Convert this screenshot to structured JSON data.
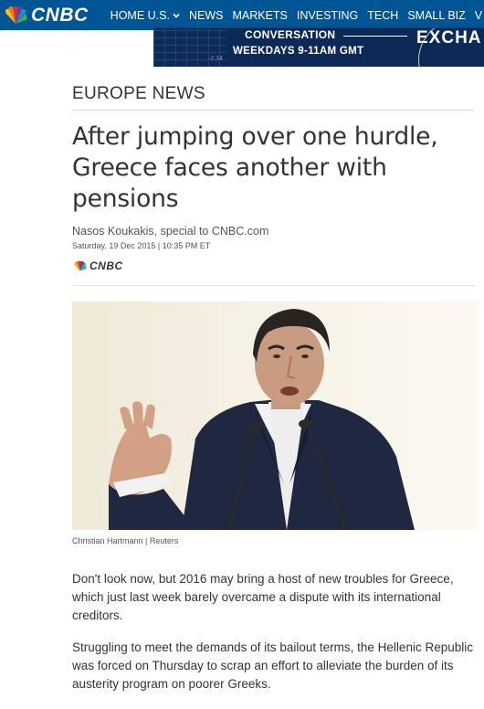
{
  "nav": {
    "logo_text": "CNBC",
    "items": [
      {
        "label": "HOME U.S.",
        "has_dropdown": true
      },
      {
        "label": "NEWS",
        "has_dropdown": false
      },
      {
        "label": "MARKETS",
        "has_dropdown": false
      },
      {
        "label": "INVESTING",
        "has_dropdown": false
      },
      {
        "label": "TECH",
        "has_dropdown": false
      },
      {
        "label": "SMALL BIZ",
        "has_dropdown": false
      },
      {
        "label": "V",
        "has_dropdown": false
      }
    ]
  },
  "ad": {
    "line1": "CONVERSATION",
    "line2": "WEEKDAYS 9-11AM GMT",
    "brand_partial": "EXCHA",
    "ticker": "-2.34"
  },
  "article": {
    "section": "EUROPE NEWS",
    "headline": "After jumping over one hurdle, Greece faces another with pensions",
    "byline": "Nasos Koukakis, special to CNBC.com",
    "date": "Saturday, 19 Dec 2015 | 10:35 PM ET",
    "source_logo_text": "CNBC",
    "photo_caption": "Christian Hartmann | Reuters",
    "paragraphs": [
      "Don't look now, but 2016 may bring a host of new troubles for Greece, which just last week barely overcame a dispute with its international creditors.",
      "Struggling to meet the demands of its bailout terms, the Hellenic Republic was forced on Thursday to scrap an effort to alleviate the burden of its austerity program on poorer Greeks."
    ]
  },
  "colors": {
    "nav_bg": "#005594",
    "ad_bg": "#0d2a56",
    "text": "#333333",
    "peacock": [
      "#f4c01e",
      "#ee7b22",
      "#d3313f",
      "#6c3f98",
      "#1b8fd0",
      "#4aaa4c"
    ]
  }
}
